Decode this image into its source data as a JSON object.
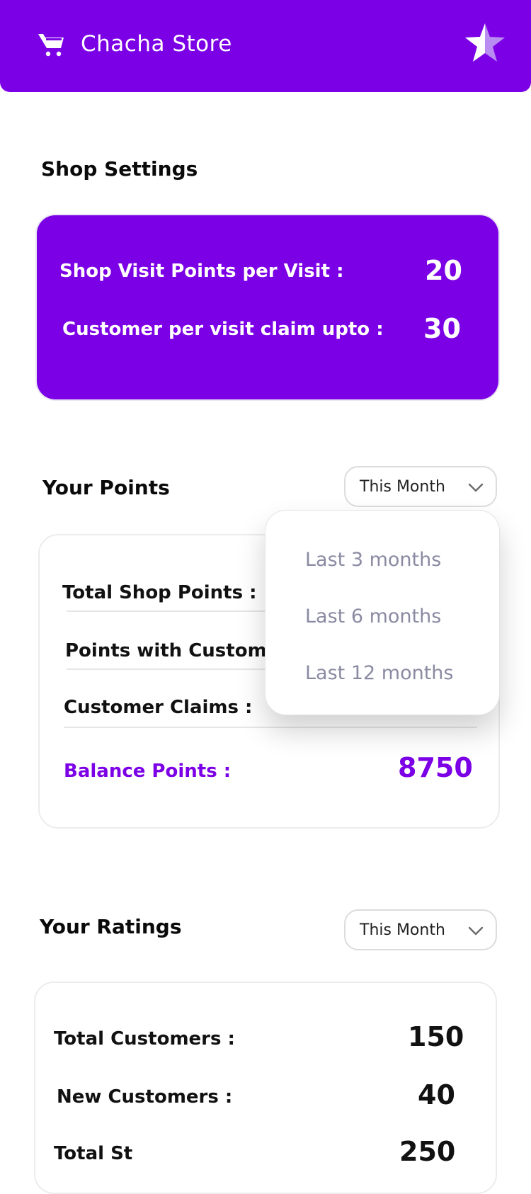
{
  "header": {
    "title": "Chacha Store",
    "icons": {
      "cart": "cart-icon",
      "star": "star-icon"
    },
    "color": "#7C00E6"
  },
  "shop_settings": {
    "title": "Shop Settings",
    "rows": [
      {
        "label": "Shop Visit Points per Visit  :",
        "value": "20"
      },
      {
        "label": "Customer per visit claim upto  :",
        "value": "30"
      }
    ]
  },
  "your_points": {
    "title": "Your Points",
    "dropdown_value": "This Month",
    "rows": [
      {
        "label": "Total Shop Points :",
        "value": ""
      },
      {
        "label": "Points with Custom",
        "value": ""
      },
      {
        "label": "Customer Claims :",
        "value": ""
      }
    ],
    "balance": {
      "label": "Balance Points :",
      "value": "8750"
    }
  },
  "dropdown_menu": {
    "options": [
      "Last 3 months",
      "Last 6 months",
      "Last 12 months"
    ]
  },
  "your_ratings": {
    "title": "Your Ratings",
    "dropdown_value": "This Month",
    "rows": [
      {
        "label": "Total Customers  :",
        "value": "150"
      },
      {
        "label": "New Customers :",
        "value": "40"
      },
      {
        "label": "Total St",
        "value": "250"
      }
    ]
  },
  "colors": {
    "accent": "#7C00E6",
    "menu_text": "#8a8aa2"
  }
}
